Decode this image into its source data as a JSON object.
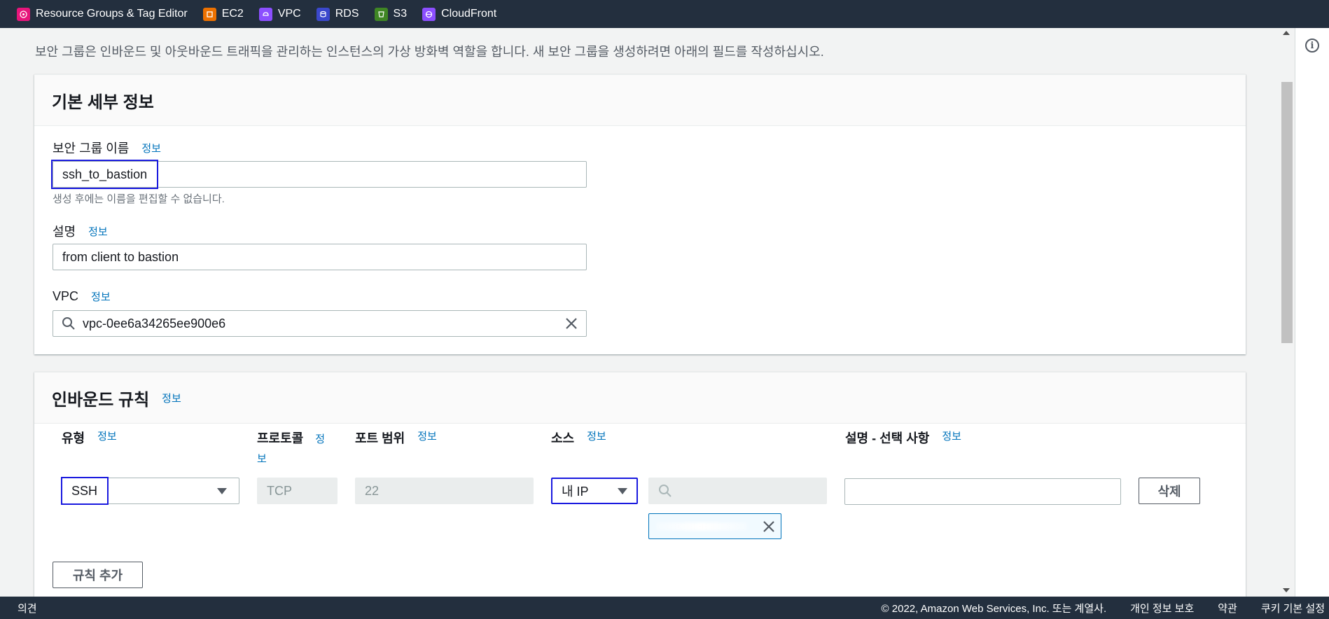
{
  "bookmarks": [
    {
      "label": "Resource Groups & Tag Editor",
      "icon": "resource-groups-icon",
      "color": "#e7157b"
    },
    {
      "label": "EC2",
      "icon": "ec2-icon",
      "color": "#ed7100"
    },
    {
      "label": "VPC",
      "icon": "vpc-icon",
      "color": "#8c4fff"
    },
    {
      "label": "RDS",
      "icon": "rds-icon",
      "color": "#3b48cc"
    },
    {
      "label": "S3",
      "icon": "s3-icon",
      "color": "#3f8624"
    },
    {
      "label": "CloudFront",
      "icon": "cloudfront-icon",
      "color": "#8c4fff"
    }
  ],
  "intro": "보안 그룹은 인바운드 및 아웃바운드 트래픽을 관리하는 인스턴스의 가상 방화벽 역할을 합니다. 새 보안 그룹을 생성하려면 아래의 필드를 작성하십시오.",
  "basic": {
    "title": "기본 세부 정보",
    "info": "정보",
    "name_label": "보안 그룹 이름",
    "name_value": "ssh_to_bastion",
    "name_hint": "생성 후에는 이름을 편집할 수 없습니다.",
    "desc_label": "설명",
    "desc_value": "from client to bastion",
    "vpc_label": "VPC",
    "vpc_value": "vpc-0ee6a34265ee900e6"
  },
  "inbound": {
    "title": "인바운드 규칙",
    "info": "정보",
    "col_type": "유형",
    "col_protocol": "프로토콜",
    "col_port": "포트 범위",
    "col_source": "소스",
    "col_desc": "설명 - 선택 사항",
    "info_short_a": "정",
    "info_short_b": "보",
    "rule": {
      "type": "SSH",
      "protocol": "TCP",
      "port": "22",
      "source": "내 IP",
      "desc": ""
    },
    "delete_label": "삭제",
    "add_rule_label": "규칙 추가"
  },
  "footer": {
    "feedback": "의견",
    "copyright": "© 2022, Amazon Web Services, Inc. 또는 계열사.",
    "privacy": "개인 정보 보호",
    "terms": "약관",
    "cookies": "쿠키 기본 설정"
  },
  "side_info_glyph": "i"
}
